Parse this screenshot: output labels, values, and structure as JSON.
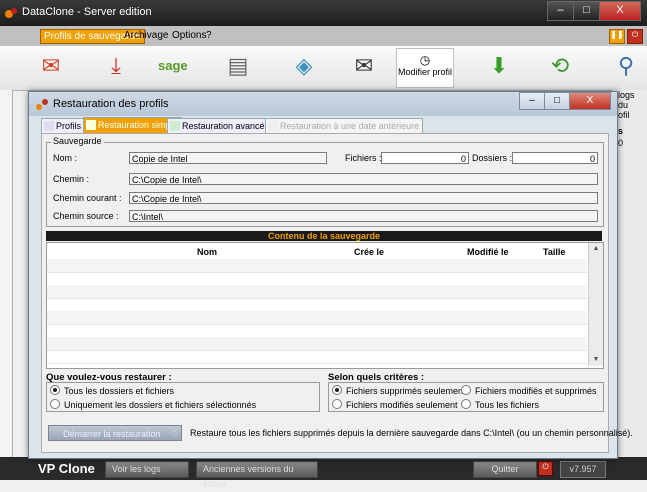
{
  "window": {
    "title": "DataClone - Server edition",
    "min": "–",
    "max": "□",
    "close": "X"
  },
  "menu": [
    "Profils de sauvegarde",
    "Archivage",
    "Options",
    "?"
  ],
  "toolbar": {
    "modify_profile": "Modifier profil",
    "sage_label": "sage",
    "side_text": "logs du\nofil"
  },
  "right_pane": {
    "label": "s",
    "value": "0"
  },
  "bottom": {
    "brand": "VP Clone",
    "logs": "Voir les logs",
    "older": "Anciennes versions du fichier",
    "quit": "Quitter",
    "version": "v7.957"
  },
  "dialog": {
    "title": "Restauration des profils",
    "tabs": [
      "Profils",
      "Restauration simple",
      "Restauration avancée",
      "Restauration à une date antérieure"
    ],
    "sauvegarde": {
      "legend": "Sauvegarde",
      "nom_label": "Nom :",
      "nom": "Copie de Intel",
      "fichiers_label": "Fichiers :",
      "fichiers": "0",
      "dossiers_label": "Dossiers :",
      "dossiers": "0",
      "chemin_label": "Chemin :",
      "chemin": "C:\\Copie de Intel\\",
      "chemin_courant_label": "Chemin courant :",
      "chemin_courant": "C:\\Copie de Intel\\",
      "chemin_source_label": "Chemin source :",
      "chemin_source": "C:\\Intel\\"
    },
    "content_title": "Contenu de la sauvegarde",
    "columns": [
      "Nom",
      "Crée le",
      "Modifié le",
      "Taille"
    ],
    "restore_question": "Que voulez-vous restaurer :",
    "restore_options": [
      "Tous les dossiers et fichiers",
      "Uniquement les dossiers et fichiers sélectionnés"
    ],
    "criteria_title": "Selon quels critères :",
    "criteria_options": [
      "Fichiers supprimés seulement",
      "Fichiers modifiés et supprimés",
      "Fichiers modifiés seulement",
      "Tous les fichiers"
    ],
    "start_button": "Démarrer la restauration",
    "hint": "Restaure tous les fichiers supprimés depuis la dernière sauvegarde dans C:\\Intel\\ (ou un chemin personnalisé)."
  }
}
